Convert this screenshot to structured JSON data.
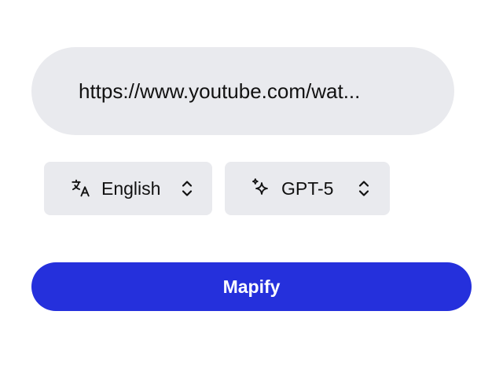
{
  "url_input": {
    "value": "https://www.youtube.com/wat..."
  },
  "language_select": {
    "icon": "translate-icon",
    "selected": "English",
    "chevron_icon": "chevron-up-down-icon"
  },
  "model_select": {
    "icon": "sparkles-icon",
    "selected": "GPT-5",
    "chevron_icon": "chevron-up-down-icon"
  },
  "submit_button": {
    "label": "Mapify"
  },
  "colors": {
    "field_background": "#e9eaee",
    "accent": "#2530dc",
    "text": "#111111",
    "button_text": "#ffffff"
  }
}
